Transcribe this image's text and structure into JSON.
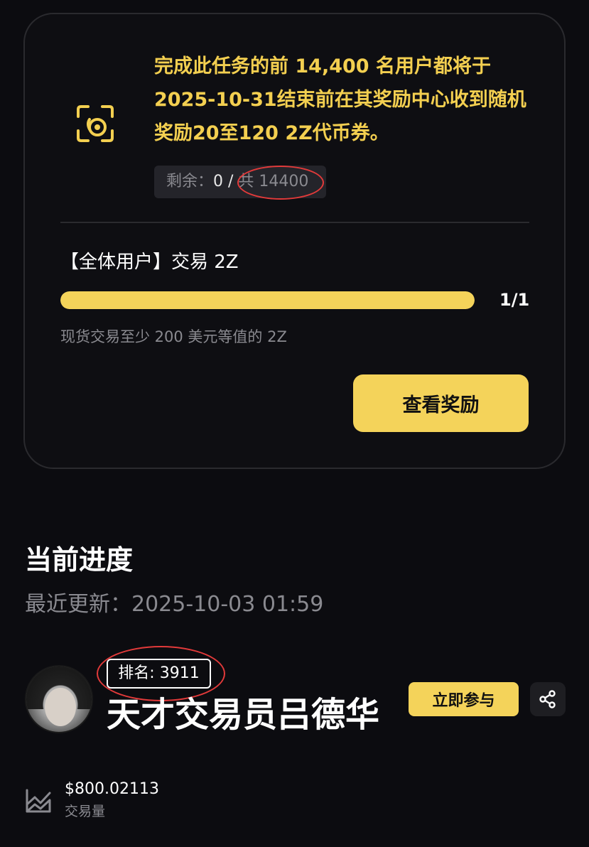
{
  "task_card": {
    "reward_text": "完成此任务的前 14,400 名用户都将于 2025-10-31结束前在其奖励中心收到随机奖励20至120 2Z代币券。",
    "remaining_label": "剩余：",
    "remaining_value": "0",
    "remaining_sep": " / ",
    "remaining_total": "共 14400",
    "task_title": "【全体用户】交易 2Z",
    "progress_fraction": 1.0,
    "progress_text": "1/1",
    "task_desc": "现货交易至少 200 美元等值的 2Z",
    "view_reward_label": "查看奖励"
  },
  "progress_section": {
    "title": "当前进度",
    "update_label": "最近更新：",
    "update_time": "2025-10-03 01:59"
  },
  "user": {
    "rank_text": "排名: 3911",
    "name": "天才交易员吕德华",
    "join_label": "立即参与"
  },
  "stats": {
    "volume_value": "$800.02113",
    "volume_label": "交易量"
  },
  "colors": {
    "accent": "#f4d35a",
    "gold_text": "#f3cf50",
    "annotation": "#e23a3a",
    "background": "#0c0c10"
  },
  "icons": [
    "reward-scan-icon",
    "share-icon",
    "volume-chart-icon"
  ]
}
